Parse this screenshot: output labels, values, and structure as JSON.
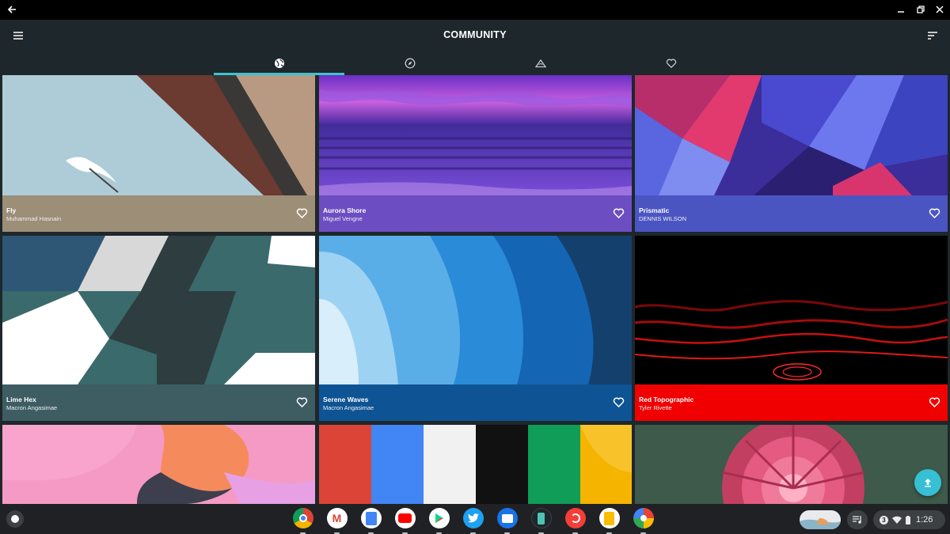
{
  "window": {
    "back_icon": "arrow-left-icon",
    "controls": [
      "minimize-icon",
      "restore-icon",
      "close-icon"
    ]
  },
  "appbar": {
    "title": "COMMUNITY",
    "menu_icon": "hamburger-icon",
    "sort_icon": "sort-icon",
    "accent": "#3cc3d4",
    "tabs": [
      {
        "icon": "globe-icon",
        "active": true
      },
      {
        "icon": "compass-icon",
        "active": false
      },
      {
        "icon": "mountain-icon",
        "active": false
      },
      {
        "icon": "heart-icon",
        "active": false
      }
    ]
  },
  "wallpapers": [
    {
      "name": "Fly",
      "author": "Muhammad Hasnain",
      "color": "#9d8e78"
    },
    {
      "name": "Aurora Shore",
      "author": "Miguel Vengne",
      "color": "#6d4ec2"
    },
    {
      "name": "Prismatic",
      "author": "DENNIS WILSON",
      "color": "#4b55c2"
    },
    {
      "name": "Lime Hex",
      "author": "Macron Angasimae",
      "color": "#3d5d63"
    },
    {
      "name": "Serene Waves",
      "author": "Macron Angasimae",
      "color": "#0e5494"
    },
    {
      "name": "Red Topographic",
      "author": "Tyler Rivette",
      "color": "#f00000"
    }
  ],
  "fab_icon": "upload-icon",
  "shelf": {
    "apps": [
      {
        "name": "chrome-icon",
        "color": "#db4437"
      },
      {
        "name": "gmail-icon",
        "color": "#ffffff"
      },
      {
        "name": "docs-icon",
        "color": "#4285f4"
      },
      {
        "name": "youtube-icon",
        "color": "#ff0000"
      },
      {
        "name": "play-store-icon",
        "color": "#ffffff"
      },
      {
        "name": "twitter-icon",
        "color": "#1da1f2"
      },
      {
        "name": "files-icon",
        "color": "#1a73e8"
      },
      {
        "name": "wallpaper-app-icon",
        "color": "#1e272b"
      },
      {
        "name": "pocket-casts-icon",
        "color": "#f43e37"
      },
      {
        "name": "keep-icon",
        "color": "#fbbc04"
      },
      {
        "name": "photos-icon",
        "color": "#ffffff"
      }
    ],
    "notification_count": "3",
    "time": "1:26"
  }
}
